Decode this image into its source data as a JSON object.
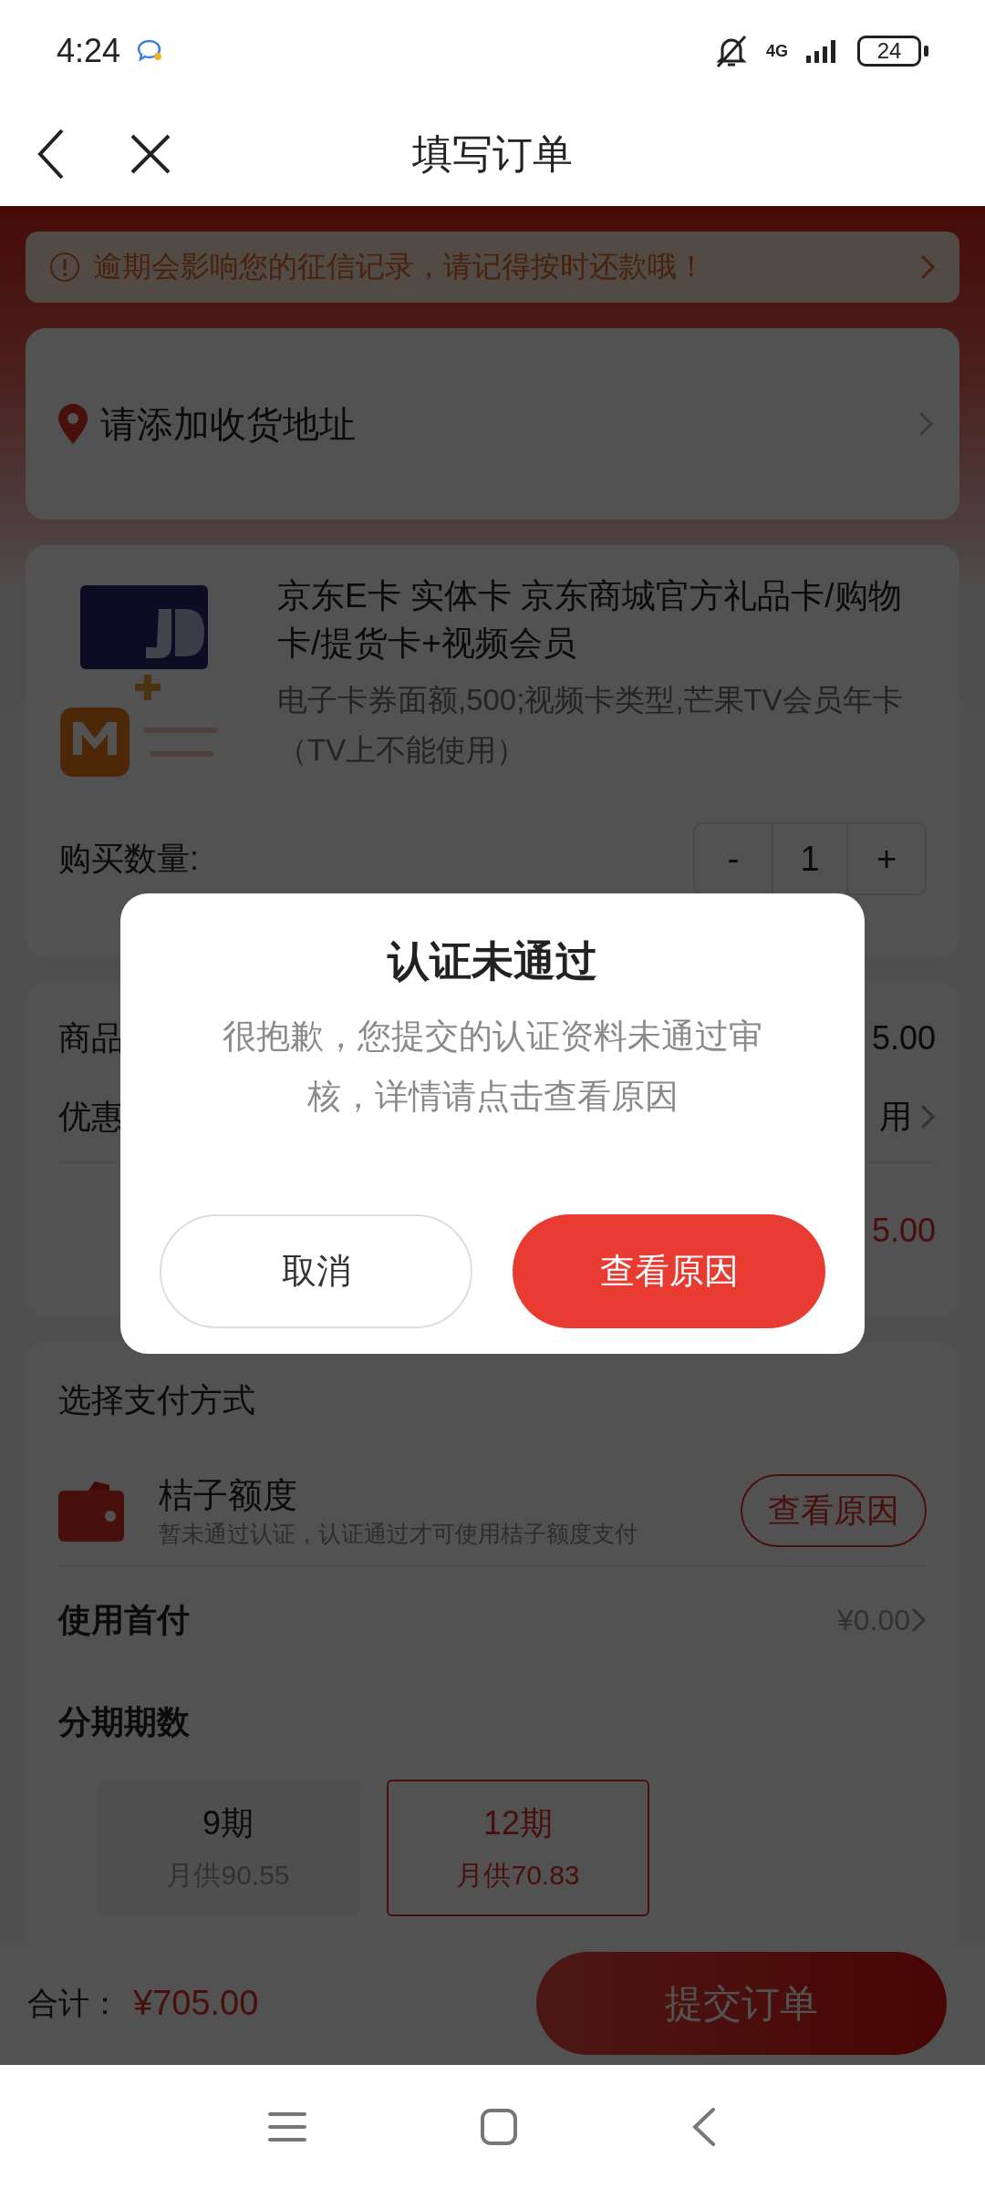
{
  "status_bar": {
    "time": "4:24",
    "network": "4G",
    "battery": "24"
  },
  "header": {
    "title": "填写订单"
  },
  "notice": {
    "text": "逾期会影响您的征信记录，请记得按时还款哦！"
  },
  "address": {
    "text": "请添加收货地址"
  },
  "product": {
    "title": "京东E卡 实体卡 京东商城官方礼品卡/购物卡/提货卡+视频会员",
    "spec": "电子卡券面额,500;视频卡类型,芒果TV会员年卡（TV上不能使用）",
    "quantity_label": "购买数量:",
    "decrement": "-",
    "quantity": "1",
    "increment": "+"
  },
  "price_rows": [
    {
      "kind": "plain",
      "label": "商品",
      "value": "5.00"
    },
    {
      "kind": "link",
      "label": "优惠",
      "value": "用"
    },
    {
      "kind": "total",
      "value": "5.00"
    }
  ],
  "payment": {
    "title": "选择支付方式",
    "method": {
      "name": "桔子额度",
      "note": "暂未通过认证，认证通过才可使用桔子额度支付",
      "button": "查看原因"
    },
    "down_payment": {
      "label": "使用首付",
      "value": "¥0.00"
    },
    "installments": {
      "title": "分期期数",
      "options": [
        {
          "term": "9期",
          "monthly": "月供90.55",
          "selected": false
        },
        {
          "term": "12期",
          "monthly": "月供70.83",
          "selected": true
        }
      ]
    }
  },
  "footer": {
    "total_label": "合计：",
    "total": "¥705.00",
    "submit": "提交订单"
  },
  "dialog": {
    "title": "认证未通过",
    "message": "很抱歉，您提交的认证资料未通过审核，详情请点击查看原因",
    "buttons": [
      {
        "kind": "secondary",
        "label": "取消"
      },
      {
        "kind": "primary",
        "label": "查看原因"
      }
    ]
  }
}
